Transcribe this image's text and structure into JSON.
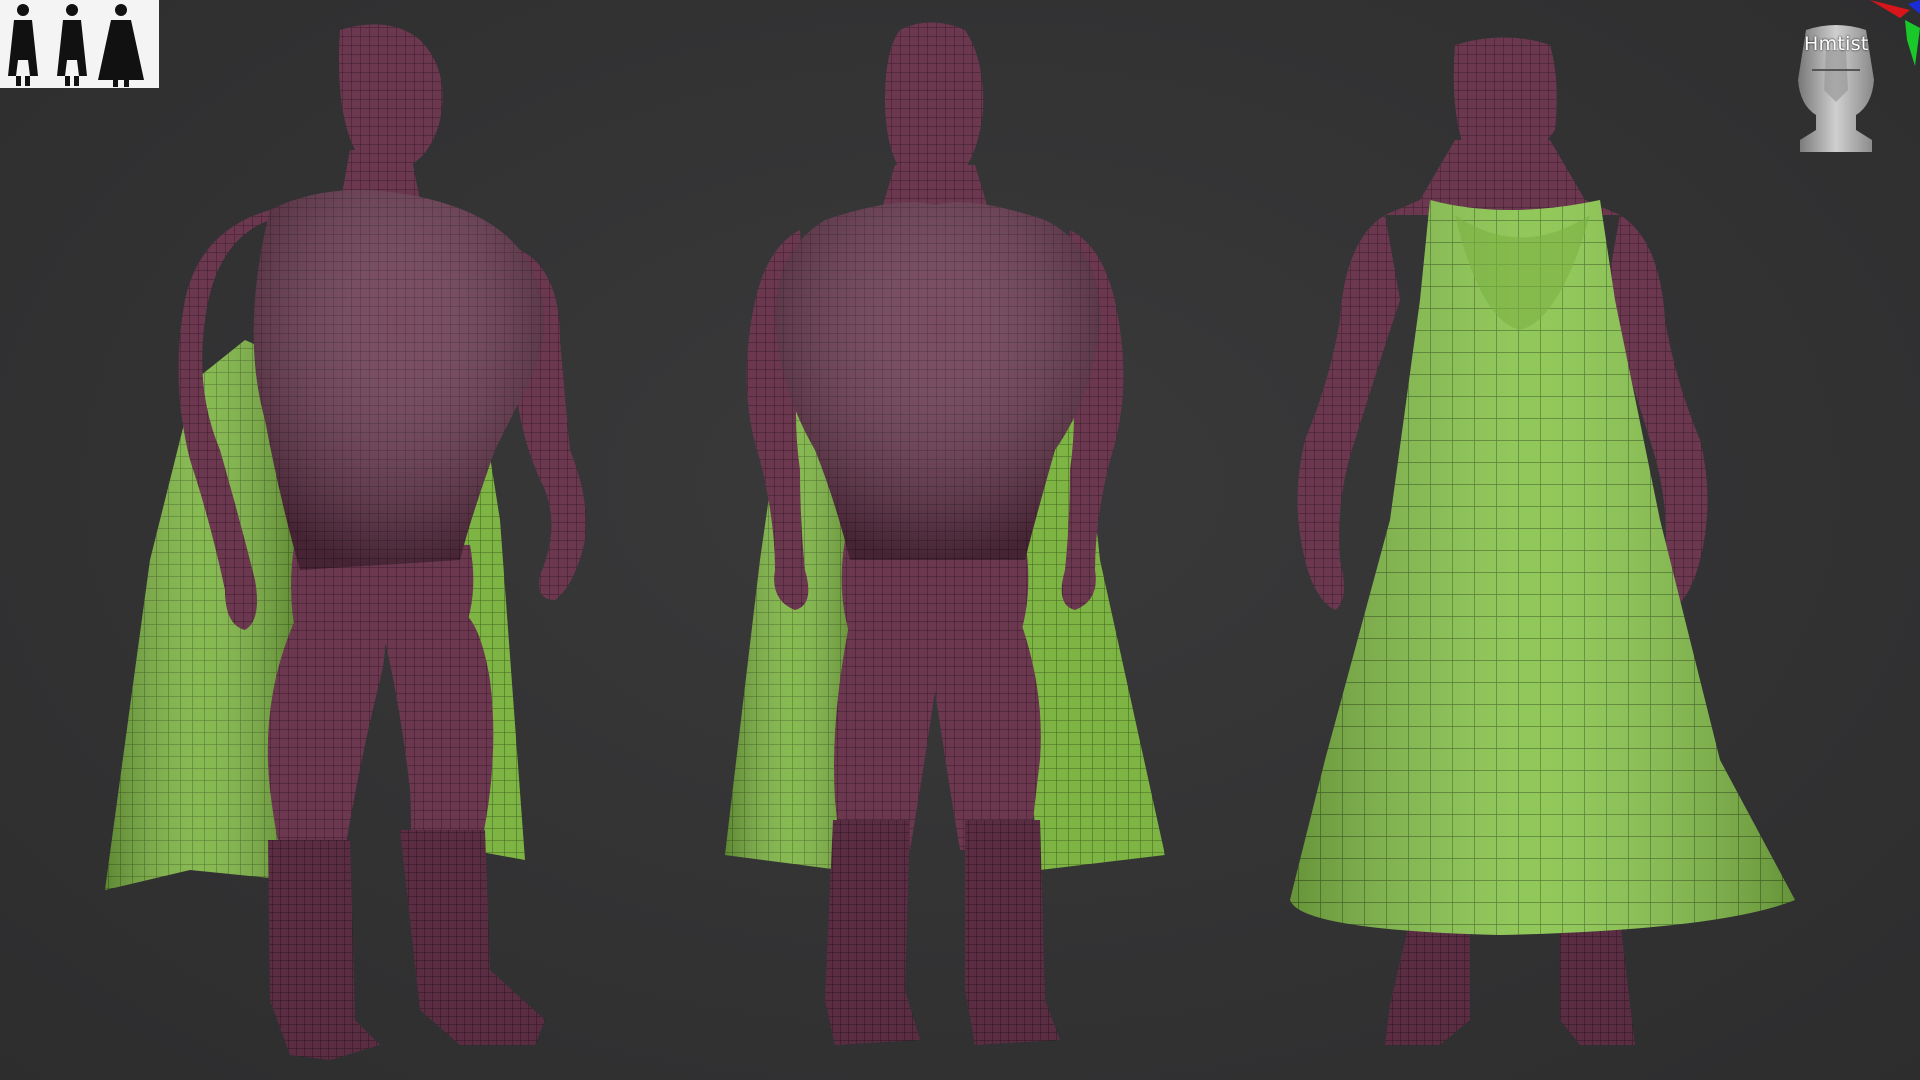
{
  "navigation_cube": {
    "label": "Hmtist"
  },
  "colors": {
    "background": "#333334",
    "body_material": "#6e3a52",
    "body_wire": "#2a1520",
    "cape_material": "#86c24a",
    "cape_wire": "#3c5f1f"
  },
  "views": [
    {
      "name": "three-quarter"
    },
    {
      "name": "front"
    },
    {
      "name": "back"
    }
  ]
}
